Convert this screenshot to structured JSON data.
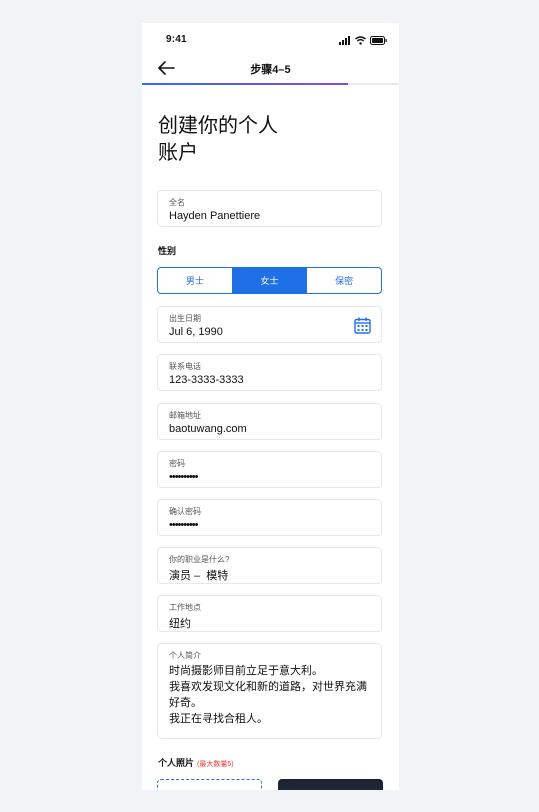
{
  "status": {
    "time": "9:41"
  },
  "nav": {
    "title": "步骤4–5",
    "progress": 0.8
  },
  "page": {
    "title_line1": "创建你的个人",
    "title_line2": "账户"
  },
  "fields": {
    "full_name": {
      "label": "全名",
      "value": "Hayden Panettiere"
    },
    "gender": {
      "label": "性别",
      "options": [
        "男士",
        "女士",
        "保密"
      ],
      "selected": "女士"
    },
    "birthday": {
      "label": "出生日期",
      "value": "Jul 6, 1990"
    },
    "phone": {
      "label": "联系电话",
      "value": "123-3333-3333"
    },
    "email": {
      "label": "邮箱地址",
      "value": "baotuwang.com"
    },
    "password": {
      "label": "密码",
      "value": "••••••••••"
    },
    "confirm_password": {
      "label": "确认密码",
      "value": "••••••••••"
    },
    "occupation": {
      "label": "你的职业是什么?",
      "value": "演员 –  模特"
    },
    "location": {
      "label": "工作地点",
      "value": "纽约"
    },
    "bio": {
      "label": "个人简介",
      "lines": [
        "时尚摄影师目前立足于意大利。",
        "我喜欢发现文化和新的道路，对世界充满",
        "好奇。",
        "我正在寻找合租人。"
      ]
    }
  },
  "photos": {
    "label": "个人照片",
    "hint": "(最大数量5)"
  },
  "colors": {
    "accent": "#1f6fe6",
    "hint": "#e53935"
  }
}
